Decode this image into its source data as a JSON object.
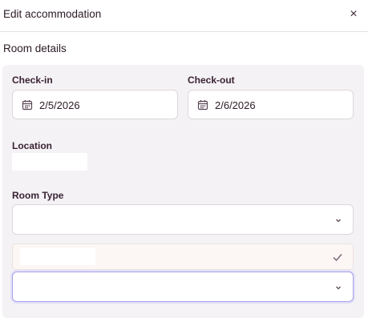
{
  "modal": {
    "title": "Edit accommodation",
    "close_symbol": "×"
  },
  "section": {
    "title": "Room details"
  },
  "checkin": {
    "label": "Check-in",
    "value": "2/5/2026",
    "icon": "calendar-icon"
  },
  "checkout": {
    "label": "Check-out",
    "value": "2/6/2026",
    "icon": "calendar-icon"
  },
  "location": {
    "label": "Location",
    "value": ""
  },
  "room_type": {
    "label": "Room Type",
    "value": "",
    "icon": "chevron-down-icon"
  },
  "dropdown": {
    "option_label": "",
    "option_selected": true,
    "check_icon": "check-icon"
  },
  "second_select": {
    "value": "",
    "icon": "chevron-down-icon"
  },
  "colors": {
    "panel_bg": "#f4f2f4",
    "focus_border": "#a7a3ea",
    "option_bg": "#fcf6f5",
    "text": "#2b1a26"
  }
}
